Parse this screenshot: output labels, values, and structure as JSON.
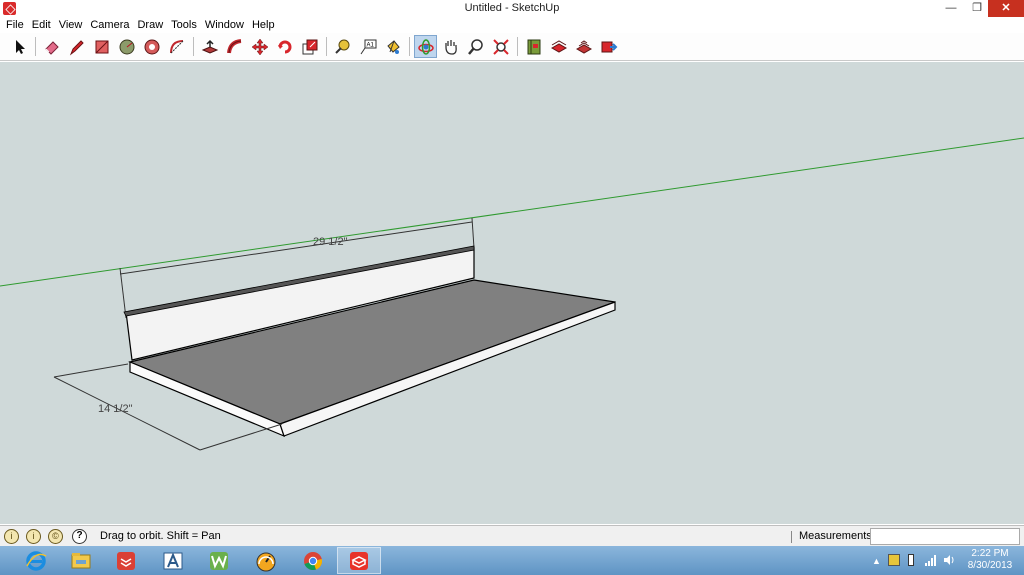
{
  "window": {
    "title": "Untitled - SketchUp",
    "min_glyph": "—",
    "max_glyph": "❐",
    "close_glyph": "✕"
  },
  "menu": [
    "File",
    "Edit",
    "View",
    "Camera",
    "Draw",
    "Tools",
    "Window",
    "Help"
  ],
  "toolbar": {
    "tools": [
      "select-icon",
      "eraser-icon",
      "pencil-line-icon",
      "rectangle-icon",
      "circle-icon",
      "polygon-icon",
      "arc-icon",
      "push-pull-icon",
      "follow-me-icon",
      "move-icon",
      "rotate-icon",
      "scale-icon",
      "tape-measure-icon",
      "text-icon",
      "paint-bucket-icon",
      "orbit-icon",
      "pan-icon",
      "zoom-icon",
      "zoom-extents-icon",
      "get-models-icon",
      "share-model-icon",
      "components-icon",
      "send-to-layout-icon"
    ],
    "active_tool": "orbit-icon"
  },
  "viewport": {
    "background": "#cfd9d9",
    "axis_color": "#2f9a2f",
    "face_top_color": "#808080",
    "face_front_color": "#f6f6f6",
    "dimensions": [
      "29 1/2\"",
      "14 1/2\""
    ]
  },
  "status": {
    "hint": "Drag to orbit.  Shift = Pan",
    "help_glyph": "?",
    "measurements_label": "Measurements",
    "measurements_value": ""
  },
  "taskbar": {
    "apps": [
      "internet-explorer-icon",
      "file-explorer-icon",
      "todoist-icon",
      "app-a-icon",
      "word-w-icon",
      "speedometer-icon",
      "chrome-icon",
      "sketchup-icon"
    ],
    "active_app": "sketchup-icon",
    "time": "2:22 PM",
    "date": "8/30/2013"
  }
}
